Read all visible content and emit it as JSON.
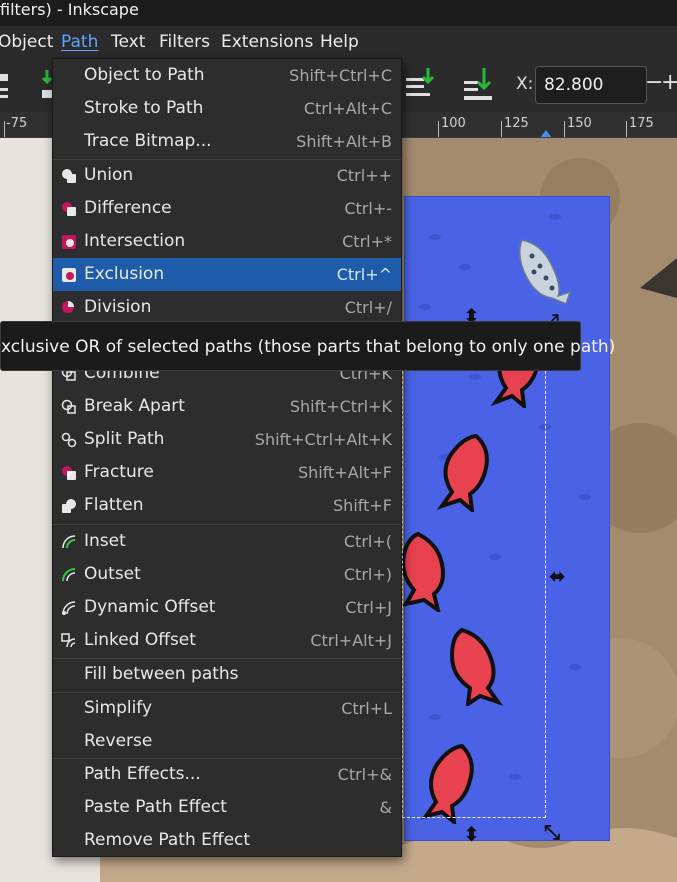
{
  "window": {
    "title": "filters) - Inkscape"
  },
  "menubar": {
    "items": [
      {
        "label": "Object"
      },
      {
        "label": "Path"
      },
      {
        "label": "Text"
      },
      {
        "label": "Filters"
      },
      {
        "label": "Extensions"
      },
      {
        "label": "Help"
      }
    ],
    "active": "Path"
  },
  "toolbar": {
    "x_label": "X:",
    "x_value": "82.800",
    "minus_label": "−",
    "plus_label": "+"
  },
  "ruler": {
    "ticks": [
      "-75",
      "100",
      "125",
      "150",
      "175"
    ]
  },
  "path_menu": {
    "items": [
      {
        "label": "Object to Path",
        "shortcut": "Shift+Ctrl+C",
        "icon": "none"
      },
      {
        "label": "Stroke to Path",
        "shortcut": "Ctrl+Alt+C",
        "icon": "none"
      },
      {
        "label": "Trace Bitmap...",
        "shortcut": "Shift+Alt+B",
        "icon": "none"
      },
      {
        "label": "Union",
        "shortcut": "Ctrl++",
        "icon": "union-icon"
      },
      {
        "label": "Difference",
        "shortcut": "Ctrl+-",
        "icon": "difference-icon"
      },
      {
        "label": "Intersection",
        "shortcut": "Ctrl+*",
        "icon": "intersection-icon"
      },
      {
        "label": "Exclusion",
        "shortcut": "Ctrl+^",
        "icon": "exclusion-icon"
      },
      {
        "label": "Division",
        "shortcut": "Ctrl+/",
        "icon": "division-icon"
      },
      {
        "label": "Combine",
        "shortcut": "Ctrl+K",
        "icon": "combine-icon"
      },
      {
        "label": "Break Apart",
        "shortcut": "Shift+Ctrl+K",
        "icon": "break-apart-icon"
      },
      {
        "label": "Split Path",
        "shortcut": "Shift+Ctrl+Alt+K",
        "icon": "split-path-icon"
      },
      {
        "label": "Fracture",
        "shortcut": "Shift+Alt+F",
        "icon": "fracture-icon"
      },
      {
        "label": "Flatten",
        "shortcut": "Shift+F",
        "icon": "flatten-icon"
      },
      {
        "label": "Inset",
        "shortcut": "Ctrl+(",
        "icon": "inset-icon"
      },
      {
        "label": "Outset",
        "shortcut": "Ctrl+)",
        "icon": "outset-icon"
      },
      {
        "label": "Dynamic Offset",
        "shortcut": "Ctrl+J",
        "icon": "dynamic-offset-icon"
      },
      {
        "label": "Linked Offset",
        "shortcut": "Ctrl+Alt+J",
        "icon": "linked-offset-icon"
      },
      {
        "label": "Fill between paths",
        "shortcut": "",
        "icon": "none"
      },
      {
        "label": "Simplify",
        "shortcut": "Ctrl+L",
        "icon": "none"
      },
      {
        "label": "Reverse",
        "shortcut": "",
        "icon": "none"
      },
      {
        "label": "Path Effects...",
        "shortcut": "Ctrl+&",
        "icon": "none"
      },
      {
        "label": "Paste Path Effect",
        "shortcut": "&",
        "icon": "none"
      },
      {
        "label": "Remove Path Effect",
        "shortcut": "",
        "icon": "none"
      }
    ],
    "highlighted": "Exclusion"
  },
  "tooltip": {
    "text": "xclusive OR of selected paths (those parts that belong to only one path)"
  },
  "colors": {
    "menu_bg": "#2d2d2d",
    "highlight": "#1e5ba8",
    "accent": "#5da4ff",
    "boolean_icon": "#c2185b",
    "offset_icon": "#2ecc40",
    "panel_blue": "#4a63e6",
    "fish_red": "#e8414f"
  }
}
